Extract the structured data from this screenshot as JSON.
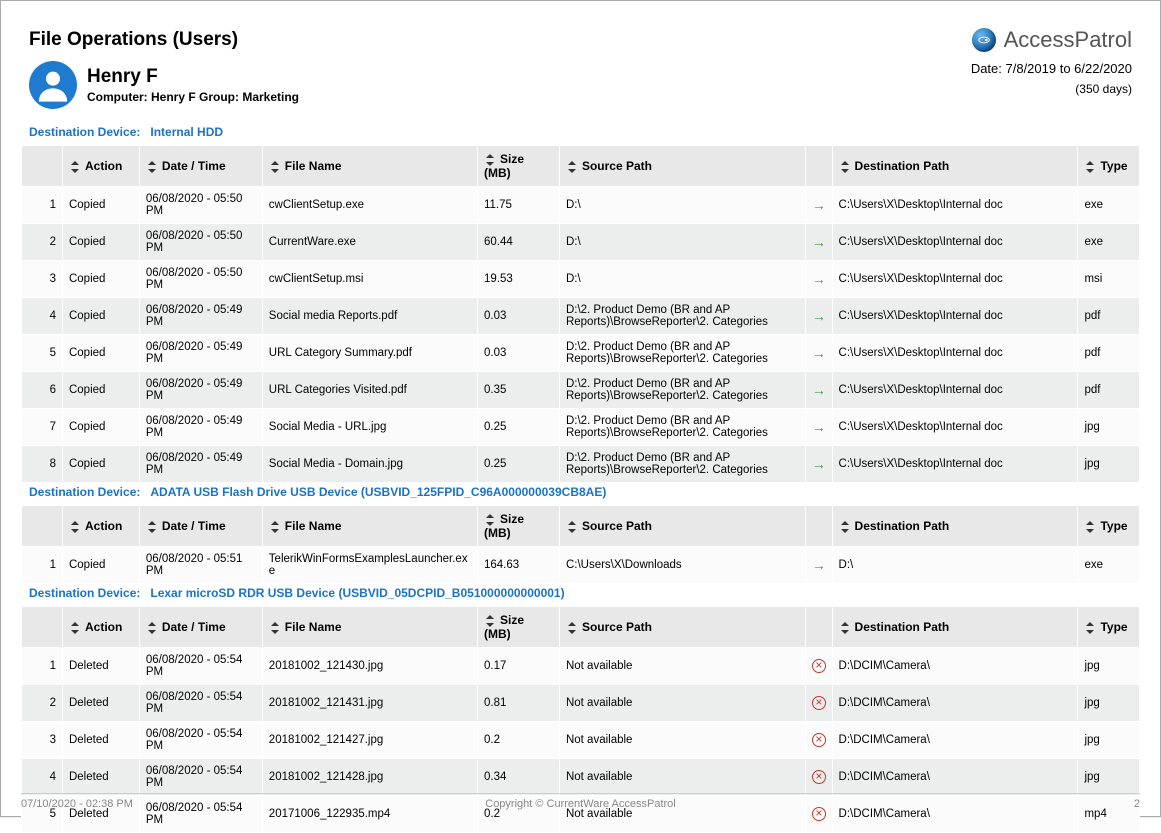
{
  "header": {
    "title": "File Operations (Users)",
    "brand": "AccessPatrol"
  },
  "user": {
    "name": "Henry F",
    "meta": "Computer: Henry F   Group: Marketing"
  },
  "range": {
    "text": "Date:  7/8/2019  to   6/22/2020",
    "days": "(350 days)"
  },
  "labels": {
    "destlabel": "Destination Device:"
  },
  "columns": {
    "action": "Action",
    "datetime": "Date / Time",
    "filename": "File Name",
    "size": "Size (MB)",
    "source": "Source Path",
    "dest": "Destination Path",
    "type": "Type"
  },
  "sections": [
    {
      "device": "Internal HDD",
      "rows": [
        {
          "idx": "1",
          "action": "Copied",
          "dt": "06/08/2020 - 05:50 PM",
          "file": "cwClientSetup.exe",
          "size": "11.75",
          "src": "D:\\",
          "status": "arrow",
          "dest": "C:\\Users\\X\\Desktop\\Internal doc",
          "type": "exe"
        },
        {
          "idx": "2",
          "action": "Copied",
          "dt": "06/08/2020 - 05:50 PM",
          "file": "CurrentWare.exe",
          "size": "60.44",
          "src": "D:\\",
          "status": "arrow",
          "dest": "C:\\Users\\X\\Desktop\\Internal doc",
          "type": "exe"
        },
        {
          "idx": "3",
          "action": "Copied",
          "dt": "06/08/2020 - 05:50 PM",
          "file": "cwClientSetup.msi",
          "size": "19.53",
          "src": "D:\\",
          "status": "arrow",
          "dest": "C:\\Users\\X\\Desktop\\Internal doc",
          "type": "msi"
        },
        {
          "idx": "4",
          "action": "Copied",
          "dt": "06/08/2020 - 05:49 PM",
          "file": "Social media Reports.pdf",
          "size": "0.03",
          "src": "D:\\2. Product Demo (BR and AP Reports)\\BrowseReporter\\2. Categories",
          "status": "arrow",
          "dest": "C:\\Users\\X\\Desktop\\Internal doc",
          "type": "pdf"
        },
        {
          "idx": "5",
          "action": "Copied",
          "dt": "06/08/2020 - 05:49 PM",
          "file": "URL Category Summary.pdf",
          "size": "0.03",
          "src": "D:\\2. Product Demo (BR and AP Reports)\\BrowseReporter\\2. Categories",
          "status": "arrow",
          "dest": "C:\\Users\\X\\Desktop\\Internal doc",
          "type": "pdf"
        },
        {
          "idx": "6",
          "action": "Copied",
          "dt": "06/08/2020 - 05:49 PM",
          "file": "URL Categories Visited.pdf",
          "size": "0.35",
          "src": "D:\\2. Product Demo (BR and AP Reports)\\BrowseReporter\\2. Categories",
          "status": "arrow",
          "dest": "C:\\Users\\X\\Desktop\\Internal doc",
          "type": "pdf"
        },
        {
          "idx": "7",
          "action": "Copied",
          "dt": "06/08/2020 - 05:49 PM",
          "file": "Social Media - URL.jpg",
          "size": "0.25",
          "src": "D:\\2. Product Demo (BR and AP Reports)\\BrowseReporter\\2. Categories",
          "status": "arrow",
          "dest": "C:\\Users\\X\\Desktop\\Internal doc",
          "type": "jpg"
        },
        {
          "idx": "8",
          "action": "Copied",
          "dt": "06/08/2020 - 05:49 PM",
          "file": "Social Media - Domain.jpg",
          "size": "0.25",
          "src": "D:\\2. Product Demo (BR and AP Reports)\\BrowseReporter\\2. Categories",
          "status": "arrow",
          "dest": "C:\\Users\\X\\Desktop\\Internal doc",
          "type": "jpg"
        }
      ]
    },
    {
      "device": "ADATA USB Flash Drive USB Device (USBVID_125FPID_C96A000000039CB8AE)",
      "rows": [
        {
          "idx": "1",
          "action": "Copied",
          "dt": "06/08/2020 - 05:51 PM",
          "file": "TelerikWinFormsExamplesLauncher.exe",
          "size": "164.63",
          "src": "C:\\Users\\X\\Downloads",
          "status": "arrow",
          "dest": "D:\\",
          "type": "exe"
        }
      ]
    },
    {
      "device": "Lexar microSD RDR USB Device (USBVID_05DCPID_B051000000000001)",
      "rows": [
        {
          "idx": "1",
          "action": "Deleted",
          "dt": "06/08/2020 - 05:54 PM",
          "file": "20181002_121430.jpg",
          "size": "0.17",
          "src": "Not available",
          "status": "x",
          "dest": "D:\\DCIM\\Camera\\",
          "type": "jpg"
        },
        {
          "idx": "2",
          "action": "Deleted",
          "dt": "06/08/2020 - 05:54 PM",
          "file": "20181002_121431.jpg",
          "size": "0.81",
          "src": "Not available",
          "status": "x",
          "dest": "D:\\DCIM\\Camera\\",
          "type": "jpg"
        },
        {
          "idx": "3",
          "action": "Deleted",
          "dt": "06/08/2020 - 05:54 PM",
          "file": "20181002_121427.jpg",
          "size": "0.2",
          "src": "Not available",
          "status": "x",
          "dest": "D:\\DCIM\\Camera\\",
          "type": "jpg"
        },
        {
          "idx": "4",
          "action": "Deleted",
          "dt": "06/08/2020 - 05:54 PM",
          "file": "20181002_121428.jpg",
          "size": "0.34",
          "src": "Not available",
          "status": "x",
          "dest": "D:\\DCIM\\Camera\\",
          "type": "jpg"
        },
        {
          "idx": "5",
          "action": "Deleted",
          "dt": "06/08/2020 - 05:54 PM",
          "file": "20171006_122935.mp4",
          "size": "0.2",
          "src": "Not available",
          "status": "x",
          "dest": "D:\\DCIM\\Camera\\",
          "type": "mp4"
        }
      ]
    }
  ],
  "footer": {
    "left": "07/10/2020 - 02:38 PM",
    "center": "Copyright © CurrentWare AccessPatrol",
    "right": "2"
  }
}
